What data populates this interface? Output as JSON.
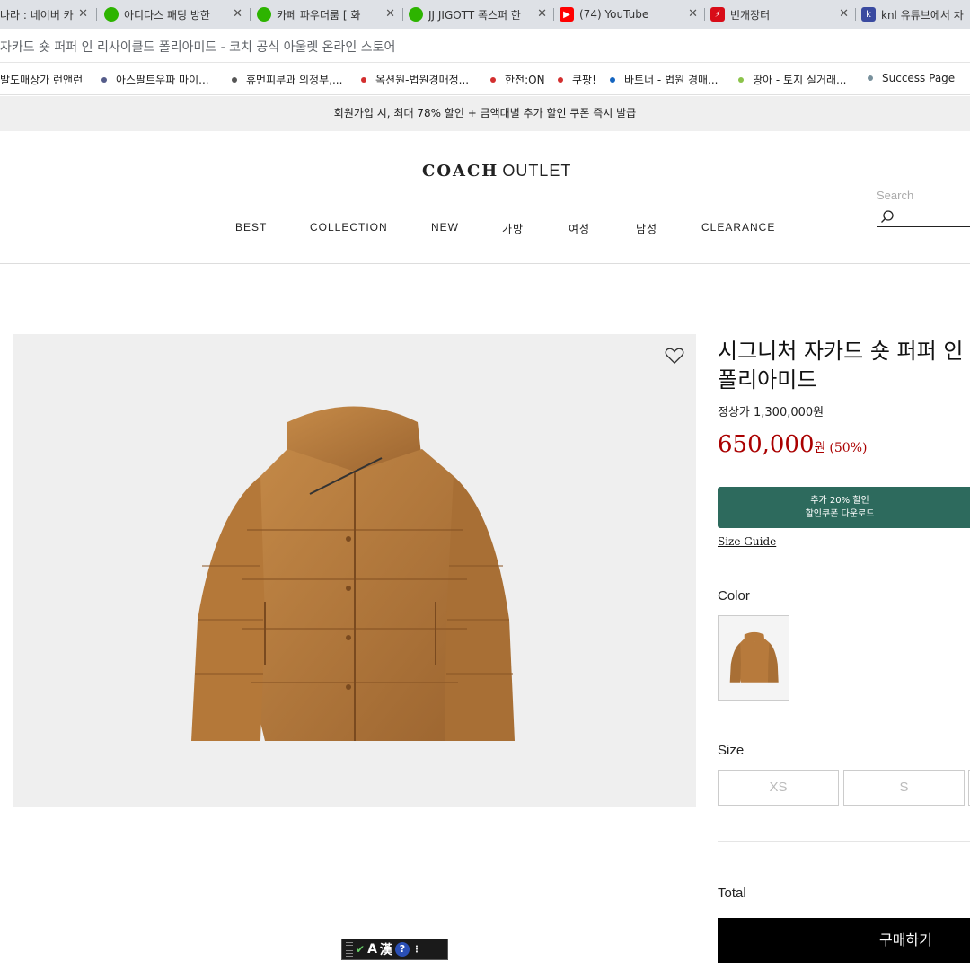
{
  "browser": {
    "tabs": [
      {
        "title": "나라 : 네이버 카",
        "icon": "naver-icon",
        "color": "#03c75a"
      },
      {
        "title": "아디다스 패딩 방한",
        "icon": "cafe-icon",
        "color": "#2db400"
      },
      {
        "title": "카페 파우더룸 [ 화",
        "icon": "cafe-icon",
        "color": "#2db400"
      },
      {
        "title": "JJ JIGOTT 폭스퍼 한",
        "icon": "cafe-icon",
        "color": "#2db400"
      },
      {
        "title": "(74) YouTube",
        "icon": "youtube-icon",
        "color": "#ff0000"
      },
      {
        "title": "번개장터",
        "icon": "bunjang-icon",
        "color": "#d80c18"
      },
      {
        "title": "knl 유튜브에서 차",
        "icon": "app-icon",
        "color": "#3a4aa0"
      }
    ],
    "address": "자카드 숏 퍼퍼 인 리사이클드 폴리아미드 - 코치 공식 아울렛 온라인 스토어",
    "bookmarks": [
      {
        "label": "발도매상가 런앤런",
        "dot": ""
      },
      {
        "label": "아스팔트우파 마이...",
        "dot": "#555c8a"
      },
      {
        "label": "휴먼피부과 의정부,...",
        "dot": "#555555"
      },
      {
        "label": "옥션원-법원경매정...",
        "dot": "#d32f2f"
      },
      {
        "label": "한전:ON",
        "dot": "#d32f2f"
      },
      {
        "label": "쿠팡!",
        "dot": "#d32f2f"
      },
      {
        "label": "바토너 - 법원 경매...",
        "dot": "#1565c0"
      },
      {
        "label": "땅아 - 토지 실거래...",
        "dot": "#8bc34a"
      },
      {
        "label": "Success Page",
        "dot": "#78909c"
      }
    ]
  },
  "promo": "회원가입 시, 최대 78% 할인 + 금액대별 추가 할인 쿠폰 즉시 발급",
  "header": {
    "logo_coach": "COACH",
    "logo_outlet": "OUTLET",
    "nav": [
      "BEST",
      "COLLECTION",
      "NEW",
      "가방",
      "여성",
      "남성",
      "CLEARANCE"
    ],
    "search_placeholder": "Search"
  },
  "product": {
    "title_line1": "시그니처 자카드 숏 퍼퍼 인",
    "title_line2": "폴리아미드",
    "regular_price": "정상가 1,300,000원",
    "sale_price": "650,000",
    "currency": "원",
    "discount": "(50%)",
    "coupon_line1": "추가 20% 할인",
    "coupon_line2": "할인쿠폰 다운로드",
    "size_guide": "Size Guide",
    "color_label": "Color",
    "size_label": "Size",
    "sizes": [
      "XS",
      "S"
    ],
    "total_label": "Total",
    "buy_label": "구매하기",
    "jacket_color": "#b77a3c"
  },
  "ime": {
    "mode": "A",
    "hanja": "漢",
    "help": "?"
  }
}
